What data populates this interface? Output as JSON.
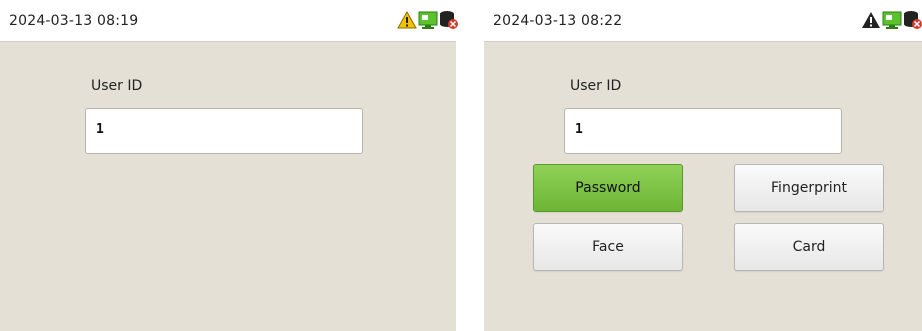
{
  "left_screen": {
    "datetime": "2024-03-13 08:19",
    "status_icons": [
      "warning-icon",
      "network-icon",
      "database-error-icon"
    ],
    "user_id_label": "User ID",
    "user_id_value": "1"
  },
  "right_screen": {
    "datetime": "2024-03-13 08:22",
    "status_icons": [
      "warning-icon",
      "network-icon",
      "database-error-icon"
    ],
    "user_id_label": "User ID",
    "user_id_value": "1",
    "buttons": {
      "password": "Password",
      "fingerprint": "Fingerprint",
      "face": "Face",
      "card": "Card"
    },
    "selected_button": "password"
  },
  "colors": {
    "panel_bg": "#e4e0d6",
    "selected_button": "#7cc444",
    "warning_left": "#f2c200",
    "warning_right": "#222222",
    "network": "#5cc12f",
    "database_error": "#d33a2c"
  }
}
